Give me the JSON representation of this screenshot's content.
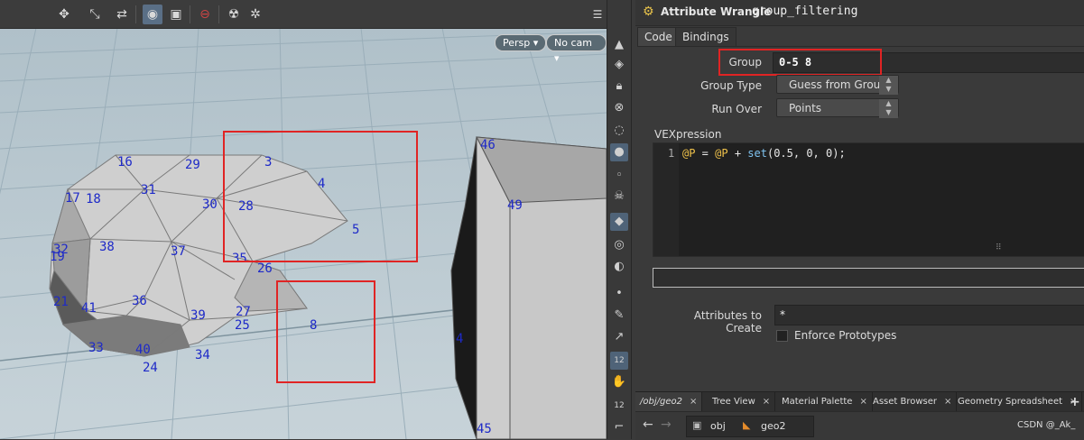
{
  "viewport": {
    "camera_persp": "Persp",
    "camera_nocam": "No cam",
    "points": [
      {
        "label": "16"
      },
      {
        "label": "29"
      },
      {
        "label": "3"
      },
      {
        "label": "4"
      },
      {
        "label": "31"
      },
      {
        "label": "17"
      },
      {
        "label": "18"
      },
      {
        "label": "30"
      },
      {
        "label": "28"
      },
      {
        "label": "5"
      },
      {
        "label": "32"
      },
      {
        "label": "19"
      },
      {
        "label": "38"
      },
      {
        "label": "37"
      },
      {
        "label": "35"
      },
      {
        "label": "26"
      },
      {
        "label": "21"
      },
      {
        "label": "41"
      },
      {
        "label": "36"
      },
      {
        "label": "39"
      },
      {
        "label": "27"
      },
      {
        "label": "25"
      },
      {
        "label": "8"
      },
      {
        "label": "33"
      },
      {
        "label": "40"
      },
      {
        "label": "34"
      },
      {
        "label": "24"
      },
      {
        "label": "46"
      },
      {
        "label": "49"
      },
      {
        "label": "4"
      },
      {
        "label": "45"
      }
    ]
  },
  "toolbar": {
    "icons": [
      "select-icon",
      "transform-icon",
      "handle-icon",
      "view-icon",
      "snap-icon",
      "record-icon",
      "bug-icon",
      "gear-icon"
    ]
  },
  "shelf": {
    "icons": [
      "arrow-up-icon",
      "geometry-icon",
      "lock-icon",
      "close-circle-icon",
      "sphere-icon",
      "bulb-icon",
      "bulb-small-icon",
      "skull-icon",
      "render-icon",
      "eye-icon",
      "display-icon",
      "dot-icon",
      "brush-icon",
      "pick-icon",
      "point-num-icon",
      "select-point-icon",
      "number-icon",
      "corner-icon"
    ],
    "badge_a": "12",
    "badge_b": "12"
  },
  "panel": {
    "node_type": "Attribute Wrangle",
    "node_name": "group_filtering",
    "tabs": [
      "Code",
      "Bindings"
    ],
    "group_label": "Group",
    "group_value": "0-5 8",
    "group_type_label": "Group Type",
    "group_type_value": "Guess from Group",
    "run_over_label": "Run Over",
    "run_over_value": "Points",
    "vex_label": "VEXpression",
    "vex_line_number": "1",
    "vex_code": {
      "p1": "@P",
      "eq": " = ",
      "p2": "@P",
      "plus": " + ",
      "fn": "set",
      "args": "(0.5, 0, 0);"
    },
    "attr_create_label": "Attributes to Create",
    "attr_create_value": "*",
    "enforce_label": "Enforce Prototypes"
  },
  "network_tabs": [
    {
      "label": "/obj/geo2"
    },
    {
      "label": "Tree View"
    },
    {
      "label": "Material Palette"
    },
    {
      "label": "Asset Browser"
    },
    {
      "label": "Geometry Spreadsheet"
    }
  ],
  "path_bar": {
    "obj": "obj",
    "geo": "geo2",
    "watermark": "CSDN @_Ak_"
  },
  "colors": {
    "highlight_red": "#e02424",
    "point_blue": "#1e2ac8"
  }
}
